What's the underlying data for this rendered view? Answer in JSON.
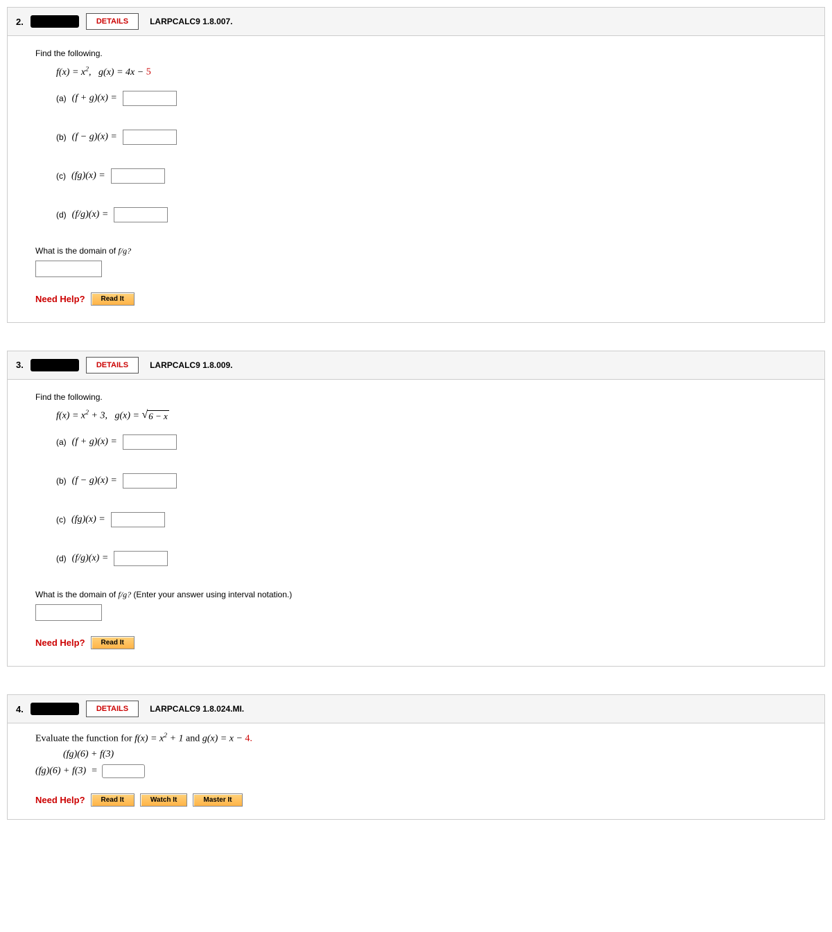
{
  "q2": {
    "number": "2.",
    "details": "DETAILS",
    "ref": "LARPCALC9 1.8.007.",
    "prompt": "Find the following.",
    "f_prefix": "f",
    "f_def_html": "f(x) = x²,",
    "g_def_pre": "g(x) = 4x − ",
    "g_def_red": "5",
    "parts": {
      "a": {
        "lbl": "(a)",
        "math": "(f + g)(x) ="
      },
      "b": {
        "lbl": "(b)",
        "math": "(f − g)(x) ="
      },
      "c": {
        "lbl": "(c)",
        "math": "(fg)(x) ="
      },
      "d": {
        "lbl": "(d)",
        "math": "(f/g)(x) ="
      }
    },
    "domain_q": "What is the domain of ",
    "domain_fg": "f/g?",
    "need_help": "Need Help?",
    "read_it": "Read It"
  },
  "q3": {
    "number": "3.",
    "details": "DETAILS",
    "ref": "LARPCALC9 1.8.009.",
    "prompt": "Find the following.",
    "f_def": "f(x) = x² + 3,",
    "g_def_pre": "g(x) = ",
    "radicand": "6 − x",
    "parts": {
      "a": {
        "lbl": "(a)",
        "math": "(f + g)(x) ="
      },
      "b": {
        "lbl": "(b)",
        "math": "(f − g)(x) ="
      },
      "c": {
        "lbl": "(c)",
        "math": "(fg)(x) ="
      },
      "d": {
        "lbl": "(d)",
        "math": "(f/g)(x) ="
      }
    },
    "domain_q_pre": "What is the domain of ",
    "domain_fg": "f/g?",
    "domain_q_post": "  (Enter your answer using interval notation.)",
    "need_help": "Need Help?",
    "read_it": "Read It"
  },
  "q4": {
    "number": "4.",
    "details": "DETAILS",
    "ref": "LARPCALC9 1.8.024.MI.",
    "prompt_pre": "Evaluate the function for ",
    "f_def": "f(x) = x² + 1",
    "and": " and ",
    "g_def_pre": "g(x) = x − ",
    "g_def_red": "4.",
    "sub_expr": "(fg)(6) + f(3)",
    "ans_lhs": "(fg)(6) + f(3)  =",
    "need_help": "Need Help?",
    "read_it": "Read It",
    "watch_it": "Watch It",
    "master_it": "Master It"
  }
}
